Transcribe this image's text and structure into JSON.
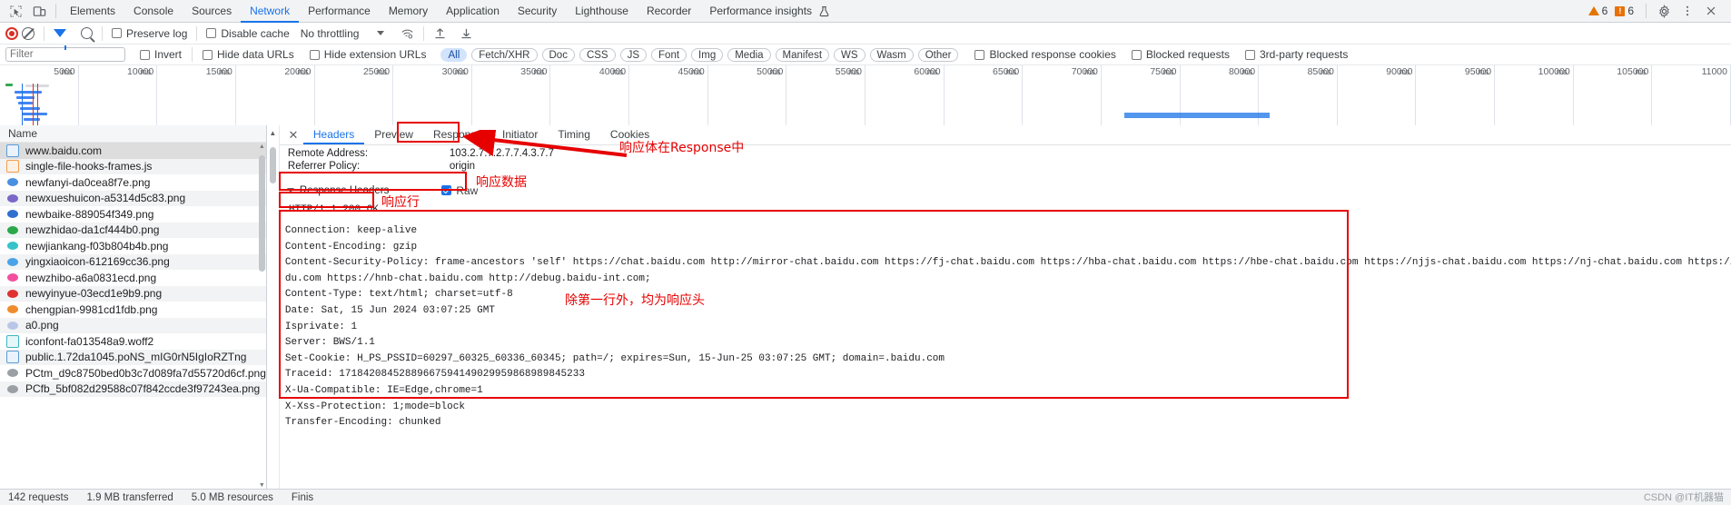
{
  "devtools": {
    "tabs": [
      {
        "label": "Elements",
        "active": false
      },
      {
        "label": "Console",
        "active": false
      },
      {
        "label": "Sources",
        "active": false
      },
      {
        "label": "Network",
        "active": true
      },
      {
        "label": "Performance",
        "active": false
      },
      {
        "label": "Memory",
        "active": false
      },
      {
        "label": "Application",
        "active": false
      },
      {
        "label": "Security",
        "active": false
      },
      {
        "label": "Lighthouse",
        "active": false
      },
      {
        "label": "Recorder",
        "active": false
      },
      {
        "label": "Performance insights",
        "active": false
      }
    ],
    "warnings_count": "6",
    "errors_count": "6",
    "error_glyph": "!",
    "inspect_icon": "inspect-element-icon",
    "device_icon": "device-toolbar-icon",
    "flask_icon": "experiment-flask-icon",
    "settings_icon": "gear-icon",
    "more_icon": "more-vertical-icon",
    "close_icon": "close-icon"
  },
  "toolbar": {
    "record_label": "record-button",
    "clear_label": "clear-button",
    "filter_icon": "filter-icon",
    "search_icon": "search-icon",
    "preserve_log": "Preserve log",
    "disable_cache": "Disable cache",
    "throttling": "No throttling",
    "network_conditions_icon": "wifi-settings-icon",
    "import_har_icon": "upload-har-icon",
    "export_har_icon": "download-har-icon"
  },
  "filterbar": {
    "filter_placeholder": "Filter",
    "filter_value": "",
    "invert": "Invert",
    "hide_data_urls": "Hide data URLs",
    "hide_extension_urls": "Hide extension URLs",
    "types": [
      {
        "label": "All",
        "active": true
      },
      {
        "label": "Fetch/XHR",
        "active": false
      },
      {
        "label": "Doc",
        "active": false
      },
      {
        "label": "CSS",
        "active": false
      },
      {
        "label": "JS",
        "active": false
      },
      {
        "label": "Font",
        "active": false
      },
      {
        "label": "Img",
        "active": false
      },
      {
        "label": "Media",
        "active": false
      },
      {
        "label": "Manifest",
        "active": false
      },
      {
        "label": "WS",
        "active": false
      },
      {
        "label": "Wasm",
        "active": false
      },
      {
        "label": "Other",
        "active": false
      }
    ],
    "blocked_response_cookies": "Blocked response cookies",
    "blocked_requests": "Blocked requests",
    "third_party_requests": "3rd-party requests"
  },
  "overview": {
    "unit": "ms",
    "ticks": [
      "5000",
      "10000",
      "15000",
      "20000",
      "25000",
      "30000",
      "35000",
      "40000",
      "45000",
      "50000",
      "55000",
      "60000",
      "65000",
      "70000",
      "75000",
      "80000",
      "85000",
      "90000",
      "95000",
      "100000",
      "105000",
      "11000"
    ]
  },
  "requests": {
    "column_header": "Name",
    "items": [
      {
        "name": "www.baidu.com",
        "type": "doc",
        "color": "#5b9bd5",
        "selected": true
      },
      {
        "name": "single-file-hooks-frames.js",
        "type": "js",
        "color": "#f29d4e",
        "selected": false
      },
      {
        "name": "newfanyi-da0cea8f7e.png",
        "type": "img",
        "color": "#4a90e2",
        "selected": false
      },
      {
        "name": "newxueshuicon-a5314d5c83.png",
        "type": "img",
        "color": "#7b68c8",
        "selected": false
      },
      {
        "name": "newbaike-889054f349.png",
        "type": "img",
        "color": "#2f6fd0",
        "selected": false
      },
      {
        "name": "newzhidao-da1cf444b0.png",
        "type": "img",
        "color": "#2ba84a",
        "selected": false
      },
      {
        "name": "newjiankang-f03b804b4b.png",
        "type": "img",
        "color": "#35c3c9",
        "selected": false
      },
      {
        "name": "yingxiaoicon-612169cc36.png",
        "type": "img",
        "color": "#4aa3e8",
        "selected": false
      },
      {
        "name": "newzhibo-a6a0831ecd.png",
        "type": "img",
        "color": "#f2509e",
        "selected": false
      },
      {
        "name": "newyinyue-03ecd1e9b9.png",
        "type": "img",
        "color": "#e03131",
        "selected": false
      },
      {
        "name": "chengpian-9981cd1fdb.png",
        "type": "img",
        "color": "#f08c2e",
        "selected": false
      },
      {
        "name": "a0.png",
        "type": "img",
        "color": "#b9c6e8",
        "selected": false
      },
      {
        "name": "iconfont-fa013548a9.woff2",
        "type": "font",
        "color": "#3fb6c4",
        "selected": false
      },
      {
        "name": "public.1.72da1045.poNS_mIG0rN5IgIoRZTng",
        "type": "doc",
        "color": "#5b9bd5",
        "selected": false
      },
      {
        "name": "PCtm_d9c8750bed0b3c7d089fa7d55720d6cf.png",
        "type": "img",
        "color": "#9aa0a6",
        "selected": false
      },
      {
        "name": "PCfb_5bf082d29588c07f842ccde3f97243ea.png",
        "type": "img",
        "color": "#9aa0a6",
        "selected": false
      }
    ]
  },
  "detail": {
    "tabs": [
      {
        "label": "Headers",
        "active": true
      },
      {
        "label": "Preview",
        "active": false
      },
      {
        "label": "Response",
        "active": false
      },
      {
        "label": "Initiator",
        "active": false
      },
      {
        "label": "Timing",
        "active": false
      },
      {
        "label": "Cookies",
        "active": false
      }
    ],
    "close_label": "✕",
    "fields": [
      {
        "key": "Remote Address:",
        "value": "103.2.7.7.2.7.7.4.3.7.7"
      },
      {
        "key": "Referrer Policy:",
        "value": "origin"
      }
    ],
    "section_title": "Response Headers",
    "raw_label": "Raw",
    "raw_checked": true,
    "status_line": "HTTP/1.1 200 OK",
    "headers_text": "Connection: keep-alive\nContent-Encoding: gzip\nContent-Security-Policy: frame-ancestors 'self' https://chat.baidu.com http://mirror-chat.baidu.com https://fj-chat.baidu.com https://hba-chat.baidu.com https://hbe-chat.baidu.com https://njjs-chat.baidu.com https://nj-chat.baidu.com https://hna-chat.bai\ndu.com https://hnb-chat.baidu.com http://debug.baidu-int.com;\nContent-Type: text/html; charset=utf-8\nDate: Sat, 15 Jun 2024 03:07:25 GMT\nIsprivate: 1\nServer: BWS/1.1\nSet-Cookie: H_PS_PSSID=60297_60325_60336_60345; path=/; expires=Sun, 15-Jun-25 03:07:25 GMT; domain=.baidu.com\nTraceid: 17184208452889667594149029959868989845233\nX-Ua-Compatible: IE=Edge,chrome=1\nX-Xss-Protection: 1;mode=block\nTransfer-Encoding: chunked"
  },
  "annotations": [
    {
      "id": "response-tab-note",
      "text": "响应体在Response中"
    },
    {
      "id": "response-data-note",
      "text": "响应数据"
    },
    {
      "id": "status-line-note",
      "text": "响应行"
    },
    {
      "id": "headers-note",
      "text": "除第一行外，均为响应头"
    }
  ],
  "statusbar": {
    "requests": "142 requests",
    "transferred": "1.9 MB transferred",
    "resources": "5.0 MB resources",
    "finish": "Finis"
  },
  "watermark": "CSDN @IT机器猫"
}
